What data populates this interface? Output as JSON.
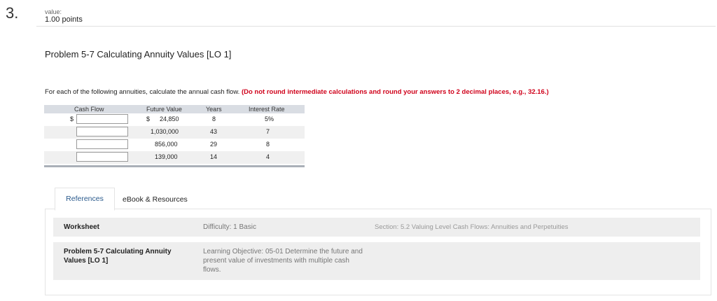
{
  "question": {
    "number": "3.",
    "value_label": "value:",
    "points": "1.00 points"
  },
  "problem": {
    "title": "Problem 5-7 Calculating Annuity Values [LO 1]",
    "instruction": "For each of the following annuities, calculate the annual cash flow.",
    "warning": "(Do not round intermediate calculations and round your answers to 2 decimal places, e.g., 32.16.)"
  },
  "table": {
    "headers": {
      "cash_flow": "Cash Flow",
      "future_value": "Future Value",
      "years": "Years",
      "interest_rate": "Interest Rate"
    },
    "currency": "$",
    "rows": [
      {
        "cash_flow": "",
        "fv_currency": "$",
        "future_value": "24,850",
        "years": "8",
        "rate": "5%"
      },
      {
        "cash_flow": "",
        "fv_currency": "",
        "future_value": "1,030,000",
        "years": "43",
        "rate": "7"
      },
      {
        "cash_flow": "",
        "fv_currency": "",
        "future_value": "856,000",
        "years": "29",
        "rate": "8"
      },
      {
        "cash_flow": "",
        "fv_currency": "",
        "future_value": "139,000",
        "years": "14",
        "rate": "4"
      }
    ]
  },
  "tabs": {
    "references": "References",
    "ebook": "eBook & Resources"
  },
  "references": {
    "row1": {
      "label": "Worksheet",
      "difficulty": "Difficulty: 1 Basic",
      "section": "Section: 5.2 Valuing Level Cash Flows: Annuities and Perpetuities"
    },
    "row2": {
      "label": "Problem 5-7 Calculating Annuity Values [LO 1]",
      "objective": "Learning Objective: 05-01 Determine the future and present value of investments with multiple cash flows."
    }
  }
}
